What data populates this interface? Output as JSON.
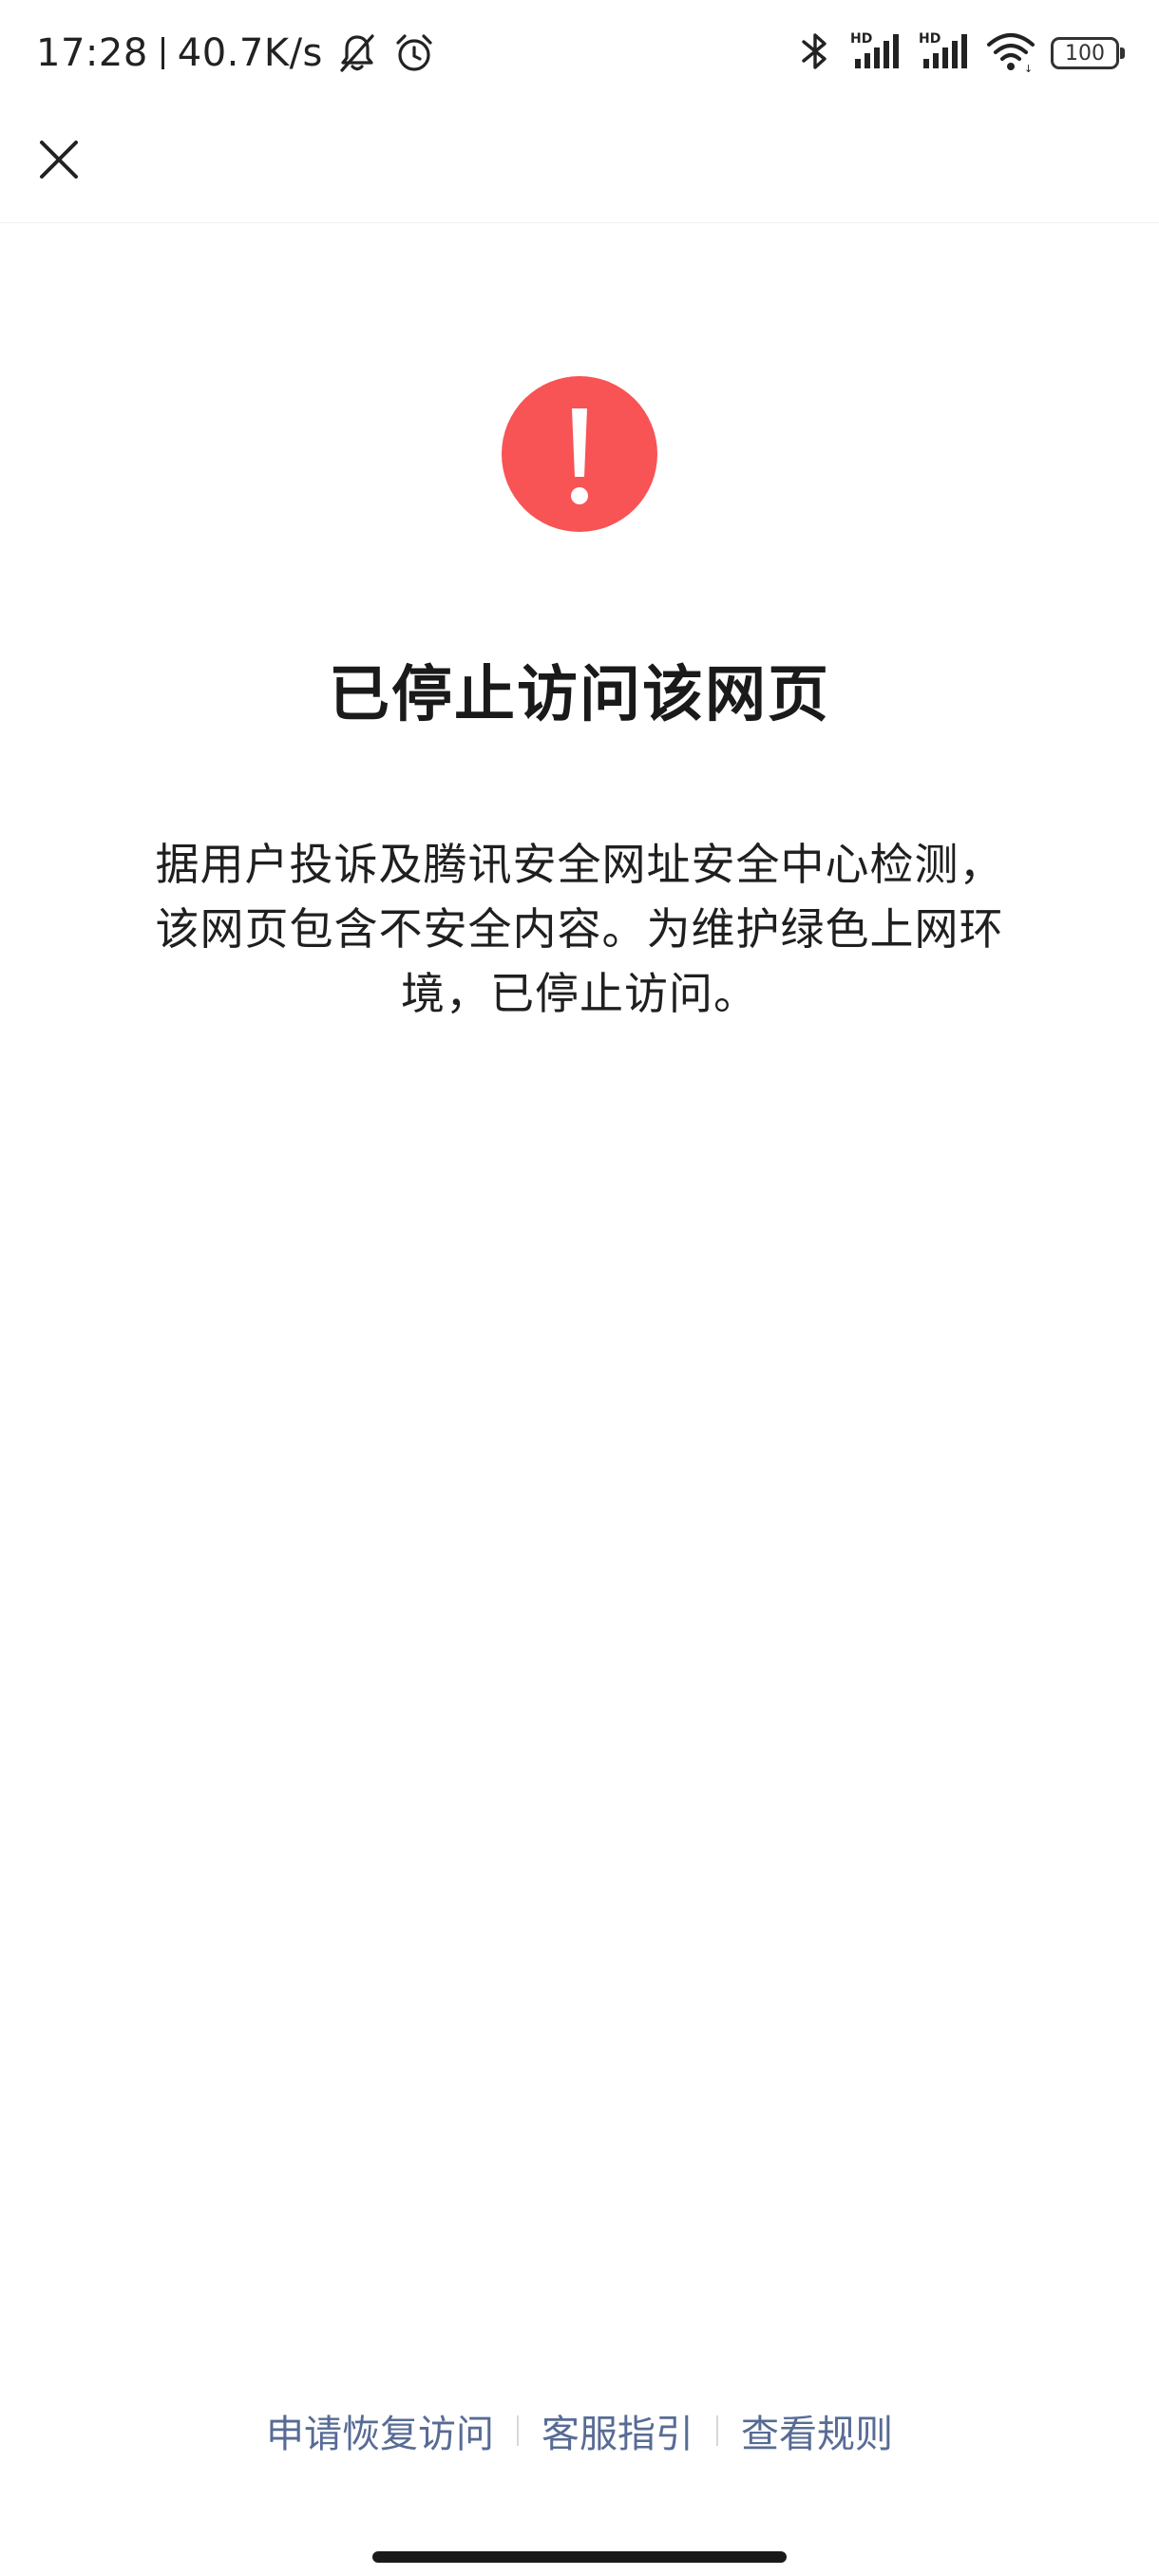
{
  "status_bar": {
    "time": "17:28",
    "network_speed": "40.7K/s",
    "battery_level": "100",
    "left_icons": [
      "bell-muted-icon",
      "alarm-icon"
    ],
    "right_icons": [
      "bluetooth-icon",
      "signal-hd-icon",
      "signal-hd-icon",
      "wifi-icon",
      "battery-icon"
    ],
    "signal_badge": "HD"
  },
  "nav": {
    "close_icon": "close-icon"
  },
  "content": {
    "warning_icon": "exclamation-circle-icon",
    "warning_color": "#f85355",
    "title": "已停止访问该网页",
    "description_lines": [
      "据用户投诉及腾讯安全网址安全中心检测，",
      "该网页包含不安全内容。为维护绿色上网环",
      "境，已停止访问。"
    ]
  },
  "footer": {
    "link_color": "#576b95",
    "links": [
      {
        "label": "申请恢复访问"
      },
      {
        "label": "客服指引"
      },
      {
        "label": "查看规则"
      }
    ]
  }
}
